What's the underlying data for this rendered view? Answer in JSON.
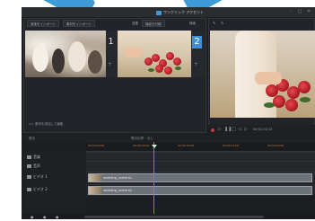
{
  "window": {
    "title": "ワンクリック アクセント",
    "controls": [
      "-",
      "□",
      "×"
    ]
  },
  "clip_panel": {
    "buttons": [
      "音楽をインポート",
      "素材をインポート"
    ],
    "sort_label": "並替",
    "sort_value": "撮影日付順",
    "search_label": "検索",
    "clips": [
      {
        "number": "1",
        "selected": false
      },
      {
        "number": "2",
        "selected": true
      }
    ],
    "footer": "素材を追加して編集"
  },
  "preview_panel": {
    "timecode": "00;01;10;13"
  },
  "timeline": {
    "toolbar": [
      "表示",
      "表示比率",
      "なし"
    ],
    "ruler_ticks": [
      "00:00:00:00",
      "00:00:05:00",
      "00:00:10:00",
      "00:00:15:00",
      "00:00:20:00"
    ],
    "tracks": [
      {
        "label": "音楽",
        "icon": "music-icon"
      },
      {
        "label": "音声",
        "icon": "audio-icon"
      },
      {
        "label": "ビデオ 1",
        "icon": "video-icon"
      },
      {
        "label": "ビデオ 2",
        "icon": "video-icon"
      }
    ],
    "clips": [
      {
        "name": "wedding_camera1",
        "track": "ビデオ 1"
      },
      {
        "name": "wedding_camera2",
        "track": "ビデオ 2"
      }
    ]
  },
  "colors": {
    "accent": "#3d8fd6",
    "background": "#1d1e21",
    "playhead": "#d6604a"
  }
}
